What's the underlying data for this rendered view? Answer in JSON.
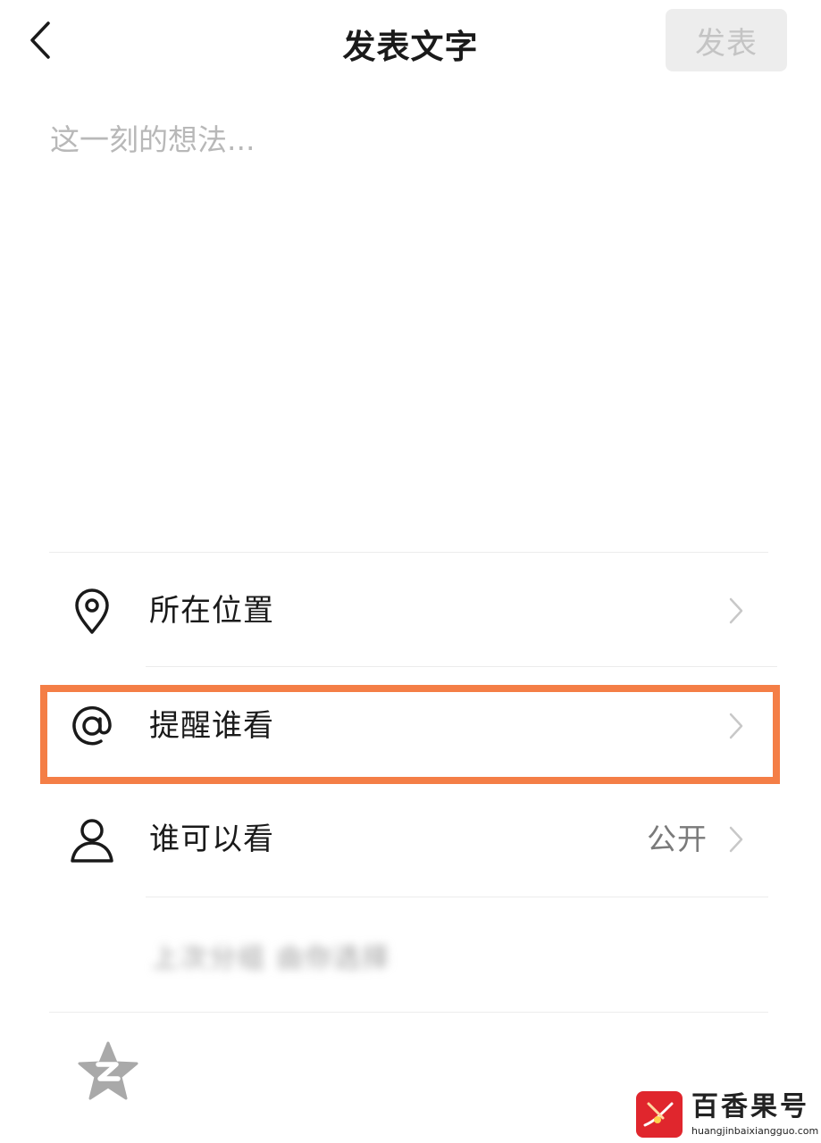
{
  "header": {
    "title": "发表文字",
    "publish_label": "发表",
    "back_icon": "chevron-left-icon"
  },
  "composer": {
    "placeholder": "这一刻的想法...",
    "value": ""
  },
  "options": [
    {
      "icon": "location-pin-icon",
      "label": "所在位置",
      "value": ""
    },
    {
      "icon": "at-sign-icon",
      "label": "提醒谁看",
      "value": ""
    },
    {
      "icon": "person-icon",
      "label": "谁可以看",
      "value": "公开"
    }
  ],
  "blurred_note": "上次分组 由你选择",
  "bottom_icon": "qzone-star-icon",
  "highlight_color": "#f47e46",
  "watermark": {
    "name": "百香果号",
    "url": "huangjinbaixiangguo.com"
  }
}
